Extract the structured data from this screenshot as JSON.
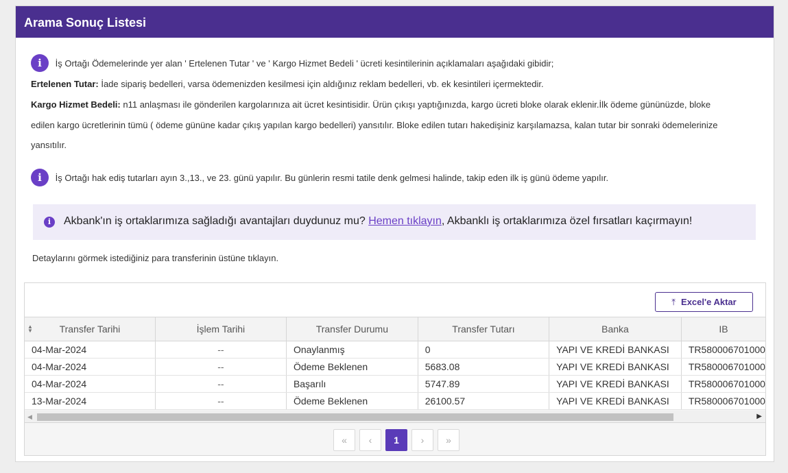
{
  "header": {
    "title": "Arama Sonuç Listesi"
  },
  "notes": {
    "info_icon": "i",
    "line1": "İş Ortağı Ödemelerinde yer alan ' Ertelenen Tutar ' ve ' Kargo Hizmet Bedeli ' ücreti kesintilerinin açıklamaları aşağıdaki gibidir;",
    "deferred_label": "Ertelenen Tutar:",
    "deferred_text": " İade sipariş bedelleri, varsa ödemenizden kesilmesi için aldığınız reklam bedelleri, vb. ek kesintileri içermektedir.",
    "cargo_label": "Kargo Hizmet Bedeli:",
    "cargo_text1": " n11 anlaşması ile gönderilen kargolarınıza ait ücret kesintisidir. Ürün çıkışı yaptığınızda, kargo ücreti bloke olarak eklenir.İlk ödeme gününüzde, bloke",
    "cargo_text2": "edilen kargo ücretlerinin tümü ( ödeme gününe kadar çıkış yapılan kargo bedelleri) yansıtılır. Bloke edilen tutarı hakedişiniz karşılamazsa, kalan tutar bir sonraki ödemelerinize",
    "cargo_text3": "yansıtılır.",
    "line_payment_days": "İş Ortağı hak ediş tutarları ayın 3.,13., ve 23. günü yapılır. Bu günlerin resmi tatile denk gelmesi halinde, takip eden ilk iş günü ödeme yapılır."
  },
  "akbank": {
    "text_before": "Akbank'ın iş ortaklarımıza sağladığı avantajları duydunuz mu? ",
    "link": "Hemen tıklayın",
    "text_after": ", Akbanklı iş ortaklarımıza özel fırsatları kaçırmayın!"
  },
  "detail_hint": "Detaylarını görmek istediğiniz para transferinin üstüne tıklayın.",
  "toolbar": {
    "excel_label": "Excel'e Aktar",
    "excel_icon": "upload-icon"
  },
  "table": {
    "columns": [
      "Transfer Tarihi",
      "İşlem Tarihi",
      "Transfer Durumu",
      "Transfer Tutarı",
      "Banka",
      "IB"
    ],
    "rows": [
      [
        "04-Mar-2024",
        "--",
        "Onaylanmış",
        "0",
        "YAPI VE KREDİ BANKASI",
        "TR580006701000"
      ],
      [
        "04-Mar-2024",
        "--",
        "Ödeme Beklenen",
        "5683.08",
        "YAPI VE KREDİ BANKASI",
        "TR580006701000"
      ],
      [
        "04-Mar-2024",
        "--",
        "Başarılı",
        "5747.89",
        "YAPI VE KREDİ BANKASI",
        "TR580006701000"
      ],
      [
        "13-Mar-2024",
        "--",
        "Ödeme Beklenen",
        "26100.57",
        "YAPI VE KREDİ BANKASI",
        "TR580006701000"
      ]
    ]
  },
  "pager": {
    "first": "«",
    "prev": "‹",
    "current": "1",
    "next": "›",
    "last": "»"
  },
  "colors": {
    "header_bg": "#4a2f8f",
    "accent": "#6a3fc6"
  }
}
